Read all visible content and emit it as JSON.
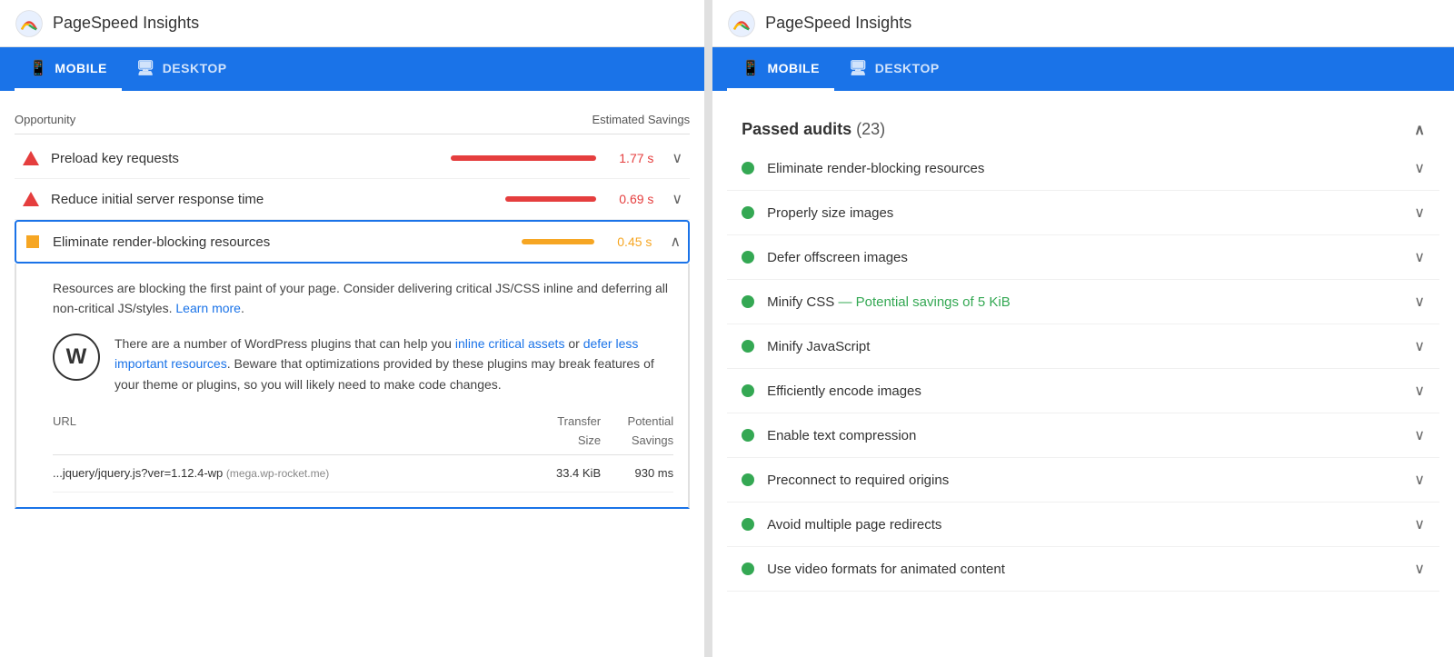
{
  "app": {
    "title": "PageSpeed Insights"
  },
  "tabs": [
    {
      "id": "mobile",
      "label": "MOBILE",
      "active": true
    },
    {
      "id": "desktop",
      "label": "DESKTOP",
      "active": false
    }
  ],
  "left_panel": {
    "table_header": {
      "opportunity": "Opportunity",
      "estimated_savings": "Estimated Savings"
    },
    "audits": [
      {
        "id": "preload",
        "icon": "triangle-red",
        "label": "Preload key requests",
        "bar_type": "bar-red",
        "savings": "1.77 s",
        "savings_color": "red",
        "expanded": false
      },
      {
        "id": "server-response",
        "icon": "triangle-red",
        "label": "Reduce initial server response time",
        "bar_type": "bar-red-short",
        "savings": "0.69 s",
        "savings_color": "red",
        "expanded": false
      },
      {
        "id": "render-blocking",
        "icon": "square-orange",
        "label": "Eliminate render-blocking resources",
        "bar_type": "bar-orange",
        "savings": "0.45 s",
        "savings_color": "orange",
        "expanded": true
      }
    ],
    "expanded_description": "Resources are blocking the first paint of your page. Consider delivering critical JS/CSS inline and deferring all non-critical JS/styles.",
    "learn_more_text": "Learn more",
    "wp_text_before": "There are a number of WordPress plugins that can help you ",
    "wp_link1": "inline critical assets",
    "wp_text_middle": " or ",
    "wp_link2": "defer less important resources",
    "wp_text_after": ". Beware that optimizations provided by these plugins may break features of your theme or plugins, so you will likely need to make code changes.",
    "url_table": {
      "url_col_label": "URL",
      "transfer_size_label": "Transfer Size",
      "potential_savings_label": "Potential Savings",
      "rows": [
        {
          "url": "...jquery/jquery.js?ver=1.12.4-wp",
          "source": "(mega.wp-rocket.me)",
          "transfer_size": "33.4 KiB",
          "potential_savings": "930 ms"
        }
      ]
    }
  },
  "right_panel": {
    "passed_audits_label": "Passed audits",
    "passed_count": "(23)",
    "audits": [
      {
        "id": "eliminate-render-blocking",
        "label": "Eliminate render-blocking resources"
      },
      {
        "id": "properly-size-images",
        "label": "Properly size images"
      },
      {
        "id": "defer-offscreen",
        "label": "Defer offscreen images"
      },
      {
        "id": "minify-css",
        "label": "Minify CSS",
        "savings": "— Potential savings of 5 KiB"
      },
      {
        "id": "minify-js",
        "label": "Minify JavaScript"
      },
      {
        "id": "encode-images",
        "label": "Efficiently encode images"
      },
      {
        "id": "text-compression",
        "label": "Enable text compression"
      },
      {
        "id": "preconnect",
        "label": "Preconnect to required origins"
      },
      {
        "id": "avoid-redirects",
        "label": "Avoid multiple page redirects"
      },
      {
        "id": "video-formats",
        "label": "Use video formats for animated content"
      }
    ]
  }
}
